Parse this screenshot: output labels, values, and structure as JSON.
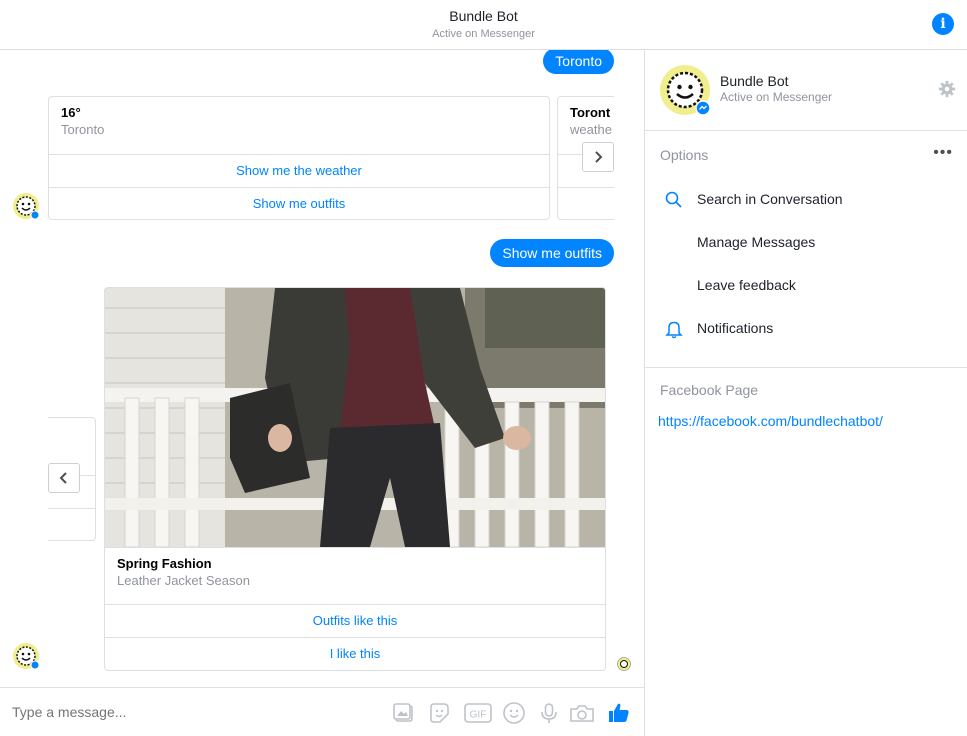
{
  "header": {
    "title": "Bundle Bot",
    "subtitle": "Active on Messenger",
    "info_icon": "info-icon"
  },
  "conversation": {
    "msg_location": "Toronto",
    "weather_card": {
      "title": "16°",
      "subtitle": "Toronto",
      "actions": [
        "Show me the weather",
        "Show me outfits"
      ]
    },
    "weather_card_next": {
      "title": "Toront",
      "subtitle": "weathe"
    },
    "msg_outfits": "Show me outfits",
    "fashion_card": {
      "title": "Spring Fashion",
      "subtitle": "Leather Jacket Season",
      "actions": [
        "Outfits like this",
        "I like this"
      ]
    }
  },
  "composer": {
    "placeholder": "Type a message...",
    "icons": [
      "image-icon",
      "sticker-icon",
      "gif-icon",
      "emoji-icon",
      "microphone-icon",
      "camera-icon",
      "thumbs-up-icon"
    ]
  },
  "panel": {
    "name": "Bundle Bot",
    "status": "Active on Messenger",
    "options_label": "Options",
    "options_more": "•••",
    "options": [
      {
        "label": "Search in Conversation",
        "icon": "search-icon"
      },
      {
        "label": "Manage Messages",
        "icon": ""
      },
      {
        "label": "Leave feedback",
        "icon": ""
      },
      {
        "label": "Notifications",
        "icon": "bell-icon"
      }
    ],
    "fb_label": "Facebook Page",
    "fb_link": "https://facebook.com/bundlechatbot/"
  },
  "colors": {
    "accent": "#0084ff",
    "divider": "#dddfe2",
    "muted_text": "#90949c",
    "avatar_yellow": "#f1ee8e"
  }
}
